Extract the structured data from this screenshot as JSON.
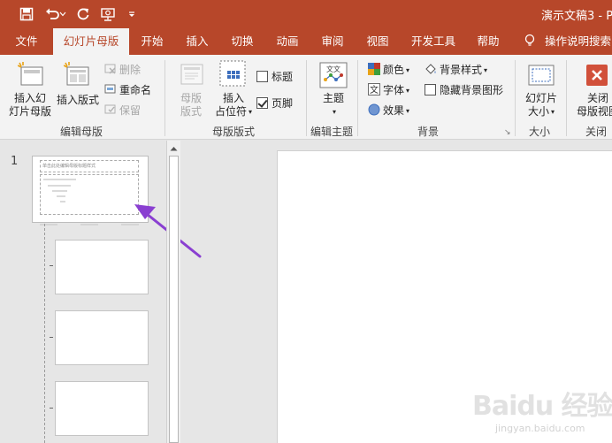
{
  "window": {
    "title": "演示文稿3 - P",
    "quick_access": [
      "save-icon",
      "undo-icon",
      "redo-icon",
      "start-from-beginning-icon",
      "customize-qat-icon"
    ],
    "accent_color": "#b7472a"
  },
  "tabs": [
    {
      "label": "文件",
      "active": false
    },
    {
      "label": "幻灯片母版",
      "active": true
    },
    {
      "label": "开始",
      "active": false
    },
    {
      "label": "插入",
      "active": false
    },
    {
      "label": "切换",
      "active": false
    },
    {
      "label": "动画",
      "active": false
    },
    {
      "label": "审阅",
      "active": false
    },
    {
      "label": "视图",
      "active": false
    },
    {
      "label": "开发工具",
      "active": false
    },
    {
      "label": "帮助",
      "active": false
    }
  ],
  "tell_me": "操作说明搜索",
  "ribbon": {
    "edit_master": {
      "insert_slide_master_line1": "插入幻",
      "insert_slide_master_line2": "灯片母版",
      "insert_layout": "插入版式",
      "delete": "删除",
      "rename": "重命名",
      "preserve": "保留",
      "group_label": "编辑母版"
    },
    "master_layout": {
      "master_layout_line1": "母版",
      "master_layout_line2": "版式",
      "insert_placeholder_line1": "插入",
      "insert_placeholder_line2": "占位符",
      "title_checkbox": "标题",
      "title_checked": false,
      "footer_checkbox": "页脚",
      "footer_checked": true,
      "group_label": "母版版式"
    },
    "edit_theme": {
      "themes": "主题",
      "group_label": "编辑主题"
    },
    "background": {
      "colors": "颜色",
      "fonts": "字体",
      "effects": "效果",
      "background_styles": "背景样式",
      "hide_background_graphics": "隐藏背景图形",
      "hide_checked": false,
      "group_label": "背景"
    },
    "size": {
      "slide_size_line1": "幻灯片",
      "slide_size_line2": "大小",
      "group_label": "大小"
    },
    "close": {
      "close_line1": "关闭",
      "close_line2": "母版视图",
      "group_label": "关闭"
    }
  },
  "thumbnails": {
    "slide_number": "1",
    "master_title_text": "单击此处编辑母版标题样式"
  },
  "watermark": {
    "logo": "Baidu 经验",
    "url": "jingyan.baidu.com"
  }
}
